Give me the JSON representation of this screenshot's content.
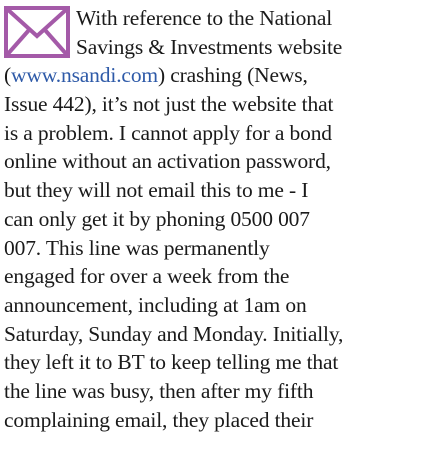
{
  "icon": {
    "name": "envelope-icon",
    "color": "#a45aa8"
  },
  "letter": {
    "line1": "With reference to the National",
    "line2": "Savings & Investments website",
    "line3_open": "(",
    "line3_link": "www.nsandi.com",
    "line3_rest": ") crashing (News,",
    "line4": "Issue 442), it’s not just the website that",
    "line5": "is a problem. I cannot apply for a bond",
    "line6": "online without an activation password,",
    "line7": "but they will not email this to me - I",
    "line8": "can only get it by phoning 0500 007",
    "line9": "007. This line was permanently",
    "line10": "engaged for over a week from the",
    "line11": "announcement, including at 1am on",
    "line12": "Saturday, Sunday and Monday. Initially,",
    "line13": "they left it to BT to keep telling me that",
    "line14": "the line was busy, then after my fifth",
    "line15": "complaining email, they placed their"
  }
}
